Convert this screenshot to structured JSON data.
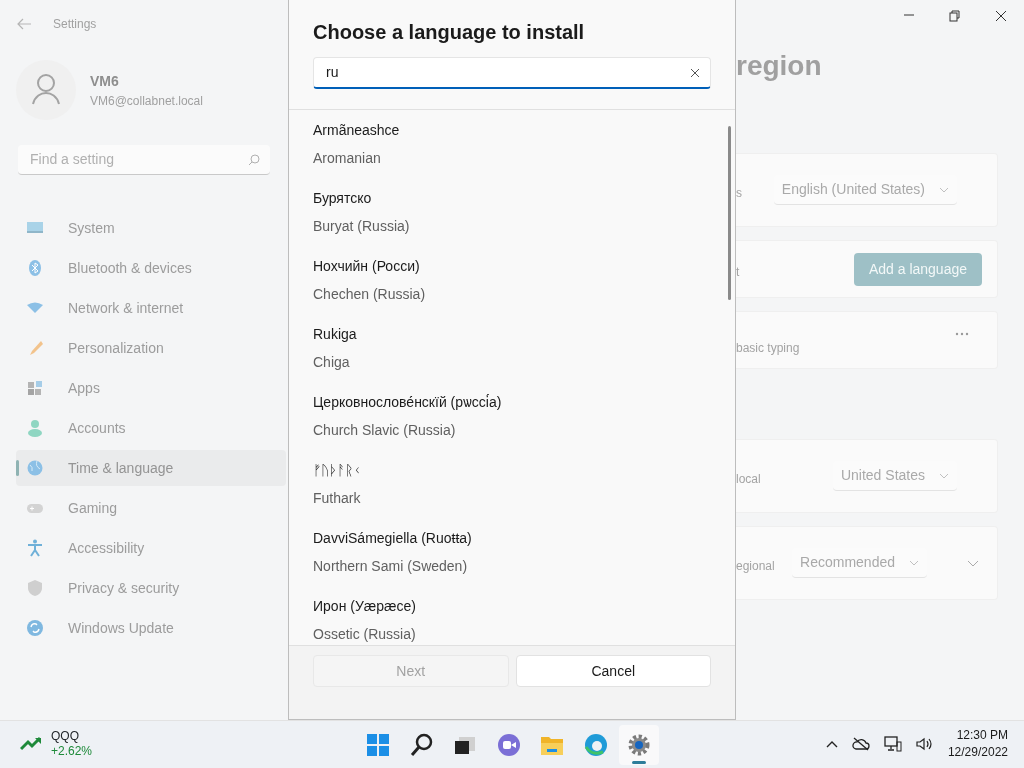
{
  "window": {
    "title": "Settings"
  },
  "user": {
    "name": "VM6",
    "email": "VM6@collabnet.local"
  },
  "search": {
    "placeholder": "Find a setting"
  },
  "sidebar": {
    "items": [
      {
        "label": "System",
        "kind": "system",
        "selected": false
      },
      {
        "label": "Bluetooth & devices",
        "kind": "bluetooth",
        "selected": false
      },
      {
        "label": "Network & internet",
        "kind": "network",
        "selected": false
      },
      {
        "label": "Personalization",
        "kind": "brush",
        "selected": false
      },
      {
        "label": "Apps",
        "kind": "apps",
        "selected": false
      },
      {
        "label": "Accounts",
        "kind": "person",
        "selected": false
      },
      {
        "label": "Time & language",
        "kind": "globe",
        "selected": true
      },
      {
        "label": "Gaming",
        "kind": "gamepad",
        "selected": false
      },
      {
        "label": "Accessibility",
        "kind": "accessibility",
        "selected": false
      },
      {
        "label": "Privacy & security",
        "kind": "shield",
        "selected": false
      },
      {
        "label": "Windows Update",
        "kind": "update",
        "selected": false
      }
    ]
  },
  "page": {
    "title": "region",
    "cards": [
      {
        "rows": [
          {
            "kind": "dropdown",
            "label": "s",
            "value": "English (United States)"
          }
        ]
      },
      {
        "rows": [
          {
            "kind": "button",
            "label": "t",
            "button": "Add a language"
          }
        ]
      },
      {
        "rows": [
          {
            "kind": "more",
            "label": "basic typing"
          }
        ]
      },
      {
        "rows": [
          {
            "kind": "dropdown",
            "label": "local",
            "value": "United States"
          }
        ],
        "gap_before": true
      },
      {
        "rows": [
          {
            "kind": "dropdown_expand",
            "label": "egional",
            "value": "Recommended"
          }
        ]
      }
    ]
  },
  "dialog": {
    "title": "Choose a language to install",
    "search": {
      "value": "ru"
    },
    "languages": [
      {
        "native": "Armãneashce",
        "english": "Aromanian"
      },
      {
        "native": "Бурятско",
        "english": "Buryat (Russia)"
      },
      {
        "native": "Нохчийн (Росси)",
        "english": "Chechen (Russia)"
      },
      {
        "native": "Rukiga",
        "english": "Chiga"
      },
      {
        "native": "Церковнослове́нскїй (рѡссі́а)",
        "english": "Church Slavic (Russia)"
      },
      {
        "native": "ᚠᚢᚦᚨᚱᚲ",
        "english": "Futhark"
      },
      {
        "native": "DavviSámegiella (Ruoŧŧa)",
        "english": "Northern Sami (Sweden)"
      },
      {
        "native": "Ирон (Уæрæсе)",
        "english": "Ossetic (Russia)"
      }
    ],
    "buttons": [
      {
        "label": "Next",
        "disabled": true
      },
      {
        "label": "Cancel",
        "disabled": false
      }
    ]
  },
  "taskbar": {
    "widget": {
      "ticker": "QQQ",
      "change": "+2.62%"
    },
    "apps": [
      {
        "kind": "start",
        "selected": false
      },
      {
        "kind": "search",
        "selected": false
      },
      {
        "kind": "taskview",
        "selected": false
      },
      {
        "kind": "chat",
        "selected": false
      },
      {
        "kind": "folder",
        "selected": false
      },
      {
        "kind": "browser",
        "selected": false
      },
      {
        "kind": "settings",
        "selected": true
      }
    ],
    "clock": {
      "time": "12:30 PM",
      "date": "12/29/2022"
    }
  }
}
